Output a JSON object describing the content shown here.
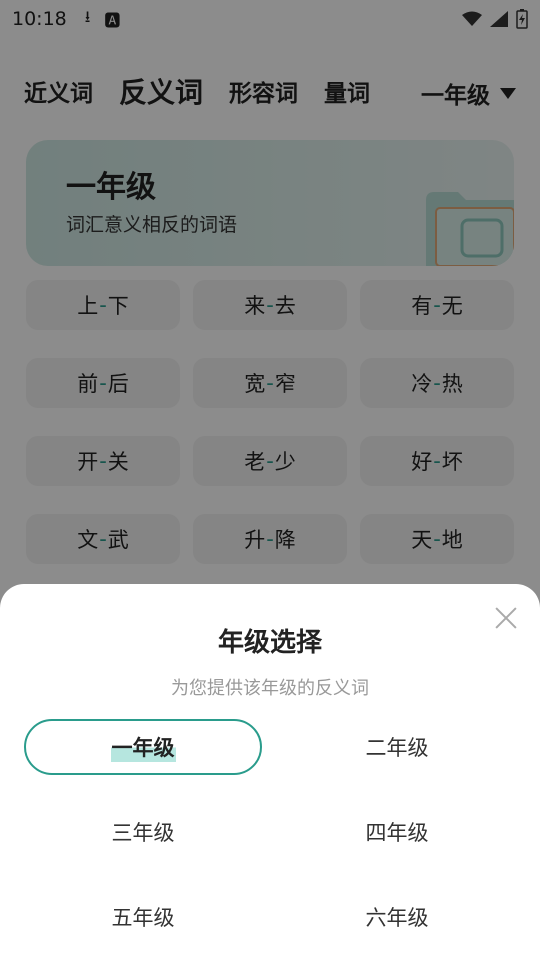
{
  "status_bar": {
    "time": "10:18",
    "icons": [
      "download-icon",
      "a-icon"
    ],
    "right_icons": [
      "wifi-icon",
      "signal-icon",
      "battery-icon"
    ]
  },
  "tabs": [
    {
      "label": "近义词"
    },
    {
      "label": "反义词"
    },
    {
      "label": "形容词"
    },
    {
      "label": "量词"
    }
  ],
  "grade_select": {
    "label": "一年级"
  },
  "banner": {
    "title": "一年级",
    "subtitle": "词汇意义相反的词语"
  },
  "words": [
    {
      "a": "上",
      "b": "下"
    },
    {
      "a": "来",
      "b": "去"
    },
    {
      "a": "有",
      "b": "无"
    },
    {
      "a": "前",
      "b": "后"
    },
    {
      "a": "宽",
      "b": "窄"
    },
    {
      "a": "冷",
      "b": "热"
    },
    {
      "a": "开",
      "b": "关"
    },
    {
      "a": "老",
      "b": "少"
    },
    {
      "a": "好",
      "b": "坏"
    },
    {
      "a": "文",
      "b": "武"
    },
    {
      "a": "升",
      "b": "降"
    },
    {
      "a": "天",
      "b": "地"
    }
  ],
  "sheet": {
    "title": "年级选择",
    "subtitle": "为您提供该年级的反义词",
    "options": [
      "一年级",
      "二年级",
      "三年级",
      "四年级",
      "五年级",
      "六年级"
    ],
    "selected": "一年级"
  },
  "colors": {
    "accent": "#2a9c8c",
    "highlight": "#b6e6df",
    "banner_bg": "#cfe9e4"
  }
}
